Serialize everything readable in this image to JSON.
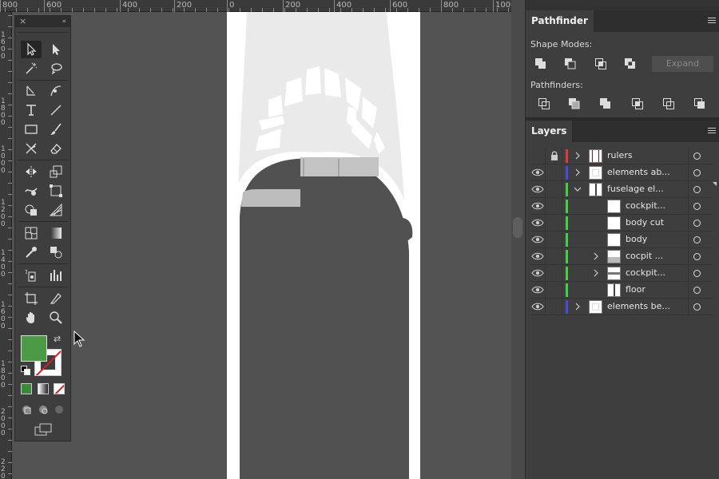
{
  "ruler_top": {
    "labels": [
      "800",
      "600",
      "400",
      "200",
      "0",
      "200",
      "400",
      "600",
      "800",
      "1000"
    ]
  },
  "ruler_left": {
    "labels": [
      "1600",
      "1800",
      "1000",
      "1200",
      "1400",
      "1600",
      "1800",
      "2000",
      "2200"
    ]
  },
  "tools_panel": {
    "close_glyph": "×",
    "collapse_glyph": "«",
    "fill_color": "#4b9a45",
    "stroke_color": "none",
    "swap_glyph": "⇄"
  },
  "pathfinder": {
    "tab_label": "Pathfinder",
    "shape_modes_label": "Shape Modes:",
    "expand_label": "Expand",
    "pathfinders_label": "Pathfinders:",
    "shape_mode_icons": [
      "unite-icon",
      "minus-front-icon",
      "intersect-icon",
      "exclude-icon"
    ],
    "pathfinder_icons": [
      "divide-icon",
      "trim-icon",
      "merge-icon",
      "crop-icon",
      "outline-icon",
      "minus-back-icon"
    ]
  },
  "layers": {
    "tab_label": "Layers",
    "rows": [
      {
        "name": "rulers",
        "visible": false,
        "locked": true,
        "color": "#e03c3c",
        "expand": "collapsed",
        "indent": 0,
        "thumb": "rulers-thumb"
      },
      {
        "name": "elements ab...",
        "visible": true,
        "locked": false,
        "color": "#4a4ad8",
        "expand": "collapsed",
        "indent": 0,
        "thumb": "elements-thumb"
      },
      {
        "name": "fuselage el...",
        "visible": true,
        "locked": false,
        "color": "#44d044",
        "expand": "expanded",
        "indent": 0,
        "thumb": "fuselage-thumb"
      },
      {
        "name": "cockpit...",
        "visible": true,
        "locked": false,
        "color": "#44d044",
        "expand": "none",
        "indent": 1,
        "thumb": "blank-thumb"
      },
      {
        "name": "body cut",
        "visible": true,
        "locked": false,
        "color": "#44d044",
        "expand": "none",
        "indent": 1,
        "thumb": "blank-thumb"
      },
      {
        "name": "body",
        "visible": true,
        "locked": false,
        "color": "#44d044",
        "expand": "none",
        "indent": 1,
        "thumb": "blank-thumb"
      },
      {
        "name": "cocpit ...",
        "visible": true,
        "locked": false,
        "color": "#44d044",
        "expand": "collapsed",
        "indent": 1,
        "thumb": "cocpit-thumb"
      },
      {
        "name": "cockpit...",
        "visible": true,
        "locked": false,
        "color": "#44d044",
        "expand": "collapsed",
        "indent": 1,
        "thumb": "cockpit2-thumb"
      },
      {
        "name": "floor",
        "visible": true,
        "locked": false,
        "color": "#44d044",
        "expand": "none",
        "indent": 1,
        "thumb": "floor-thumb"
      },
      {
        "name": "elements be...",
        "visible": true,
        "locked": false,
        "color": "#4a4ad8",
        "expand": "collapsed",
        "indent": 0,
        "thumb": "elements-thumb"
      }
    ]
  }
}
